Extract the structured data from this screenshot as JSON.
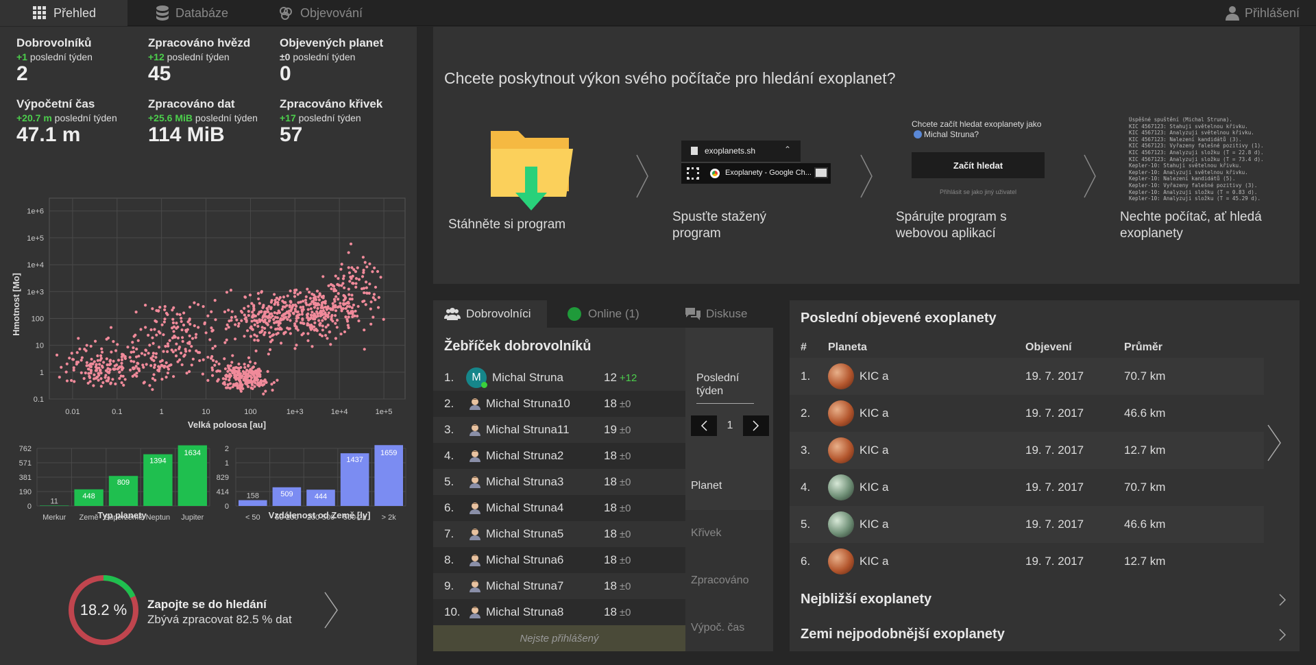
{
  "nav": {
    "tabs": [
      "Přehled",
      "Databáze",
      "Objevování"
    ],
    "login": "Přihlášení"
  },
  "stats": [
    {
      "title": "Dobrovolníků",
      "delta": "+1",
      "period": "poslední týden",
      "value": "2"
    },
    {
      "title": "Zpracováno hvězd",
      "delta": "+12",
      "period": "poslední týden",
      "value": "45"
    },
    {
      "title": "Objevených planet",
      "delta": "±0",
      "period": "poslední týden",
      "value": "0"
    },
    {
      "title": "Výpočetní čas",
      "delta": "+20.7 m",
      "period": "poslední týden",
      "value": "47.1 m"
    },
    {
      "title": "Zpracováno dat",
      "delta": "+25.6 MiB",
      "period": "poslední týden",
      "value": "114 MiB"
    },
    {
      "title": "Zpracováno křivek",
      "delta": "+17",
      "period": "poslední týden",
      "value": "57"
    }
  ],
  "chart_data": [
    {
      "type": "scatter",
      "xlabel": "Velká poloosa [au]",
      "ylabel": "Hmotnost [Mo]",
      "x_scale": "log",
      "y_scale": "log",
      "x_ticks": [
        "0.01",
        "0.1",
        "1",
        "10",
        "100",
        "1e+3",
        "1e+4",
        "1e+5"
      ],
      "y_ticks": [
        "0.1",
        "1",
        "10",
        "100",
        "1e+3",
        "1e+4",
        "1e+5",
        "1e+6"
      ],
      "xlim": [
        0.003,
        300000.0
      ],
      "ylim": [
        0.1,
        3000000.0
      ],
      "grid": true,
      "color": "#f08a9a",
      "clusters": [
        {
          "x": 0.03,
          "y": 3
        },
        {
          "x": 0.05,
          "y": 1
        },
        {
          "x": 0.3,
          "y": 2
        },
        {
          "x": 3,
          "y": 20
        },
        {
          "x": 50,
          "y": 0.8
        },
        {
          "x": 100,
          "y": 0.5
        },
        {
          "x": 300,
          "y": 100
        },
        {
          "x": 3000,
          "y": 200
        },
        {
          "x": 20000,
          "y": 1000
        }
      ]
    },
    {
      "type": "bar",
      "xlabel": "Typ planety",
      "categories": [
        "Merkur",
        "Země",
        "Superzemě",
        "Neptun",
        "Jupiter"
      ],
      "values": [
        11,
        448,
        809,
        1394,
        1634
      ],
      "y_ticks": [
        "0",
        "190",
        "381",
        "571",
        "762"
      ],
      "color": "#1fbf4f"
    },
    {
      "type": "bar",
      "xlabel": "Vzdálenost od Země [ly]",
      "categories": [
        "< 50",
        "50-200",
        "200-500",
        "500-2k",
        "> 2k"
      ],
      "values": [
        158,
        509,
        444,
        1437,
        1659
      ],
      "y_ticks": [
        "0",
        "414",
        "829",
        "1",
        "2"
      ],
      "color": "#7b8cf2"
    }
  ],
  "join": {
    "percent": "18.2 %",
    "progress": 0.182,
    "title": "Zapojte se do hledání",
    "subtitle": "Zbývá zpracovat 82.5 % dat"
  },
  "howto": {
    "title": "Chcete poskytnout výkon svého počítače pro hledání exoplanet?",
    "steps": [
      "Stáhněte si program",
      "Spusťte stažený program",
      "Spárujte program s webovou aplikací",
      "Nechte počítač, ať hledá exoplanety"
    ],
    "download_file": "exoplanets.sh",
    "taskbar_label": "Exoplanety - Google Ch...",
    "pair_prompt": "Chcete začít hledat exoplanety jako",
    "pair_user": "Michal Struna?",
    "pair_button": "Začít hledat",
    "pair_other": "Přihlásit se jako jiný uživatel",
    "log": [
      "Úspěšné spuštění (Michal Struna).",
      "KIC 4567123: Stahuji světelnou křivku.",
      "KIC 4567123: Analyzuji světelnou křivku.",
      "KIC 4567123: Nalezení kandidátů (3).",
      "KIC 4567123: Vyřazeny falešné pozitivy (1).",
      "KIC 4567123: Analyzuji složku (T = 22.8 d).",
      "KIC 4567123: Analyzuji složku (T = 73.4 d).",
      "Kepler-10: Stahuji světelnou křivku.",
      "Kepler-10: Analyzuji světelnou křivku.",
      "Kepler-10: Nalezení kandidátů (5).",
      "Kepler-10: Vyřazeny falešné pozitivy (3).",
      "Kepler-10: Analyzuji složku (T = 0.83 d).",
      "Kepler-10: Analyzuji složku (T = 45.29 d)."
    ]
  },
  "leaderboard": {
    "tabs": [
      "Dobrovolníci",
      "Online (1)",
      "Diskuse"
    ],
    "title": "Žebříček dobrovolníků",
    "rows": [
      {
        "rank": "1.",
        "name": "Michal Struna",
        "score": "12",
        "delta": "+12"
      },
      {
        "rank": "2.",
        "name": "Michal Struna10",
        "score": "18",
        "delta": "±0"
      },
      {
        "rank": "3.",
        "name": "Michal Struna11",
        "score": "19",
        "delta": "±0"
      },
      {
        "rank": "4.",
        "name": "Michal Struna2",
        "score": "18",
        "delta": "±0"
      },
      {
        "rank": "5.",
        "name": "Michal Struna3",
        "score": "18",
        "delta": "±0"
      },
      {
        "rank": "6.",
        "name": "Michal Struna4",
        "score": "18",
        "delta": "±0"
      },
      {
        "rank": "7.",
        "name": "Michal Struna5",
        "score": "18",
        "delta": "±0"
      },
      {
        "rank": "8.",
        "name": "Michal Struna6",
        "score": "18",
        "delta": "±0"
      },
      {
        "rank": "9.",
        "name": "Michal Struna7",
        "score": "18",
        "delta": "±0"
      },
      {
        "rank": "10.",
        "name": "Michal Struna8",
        "score": "18",
        "delta": "±0"
      }
    ],
    "avatar_letter": "M",
    "not_logged": "Nejste přihlášený",
    "period": "Poslední týden",
    "page": "1",
    "categories": [
      "Planet",
      "Křivek",
      "Zpracováno",
      "Výpoč. čas"
    ]
  },
  "exoplanets": {
    "title": "Poslední objevené exoplanety",
    "headers": [
      "#",
      "Planeta",
      "Objevení",
      "Průměr"
    ],
    "rows": [
      {
        "n": "1.",
        "name": "KIC a",
        "date": "19. 7. 2017",
        "diam": "70.7 km",
        "type": "gas"
      },
      {
        "n": "2.",
        "name": "KIC a",
        "date": "19. 7. 2017",
        "diam": "46.6 km",
        "type": "gas"
      },
      {
        "n": "3.",
        "name": "KIC a",
        "date": "19. 7. 2017",
        "diam": "12.7 km",
        "type": "gas"
      },
      {
        "n": "4.",
        "name": "KIC a",
        "date": "19. 7. 2017",
        "diam": "70.7 km",
        "type": "rocky"
      },
      {
        "n": "5.",
        "name": "KIC a",
        "date": "19. 7. 2017",
        "diam": "46.6 km",
        "type": "rocky"
      },
      {
        "n": "6.",
        "name": "KIC a",
        "date": "19. 7. 2017",
        "diam": "12.7 km",
        "type": "gas"
      }
    ],
    "nearest": "Nejbližší exoplanety",
    "earthlike": "Zemi nejpodobnější exoplanety"
  }
}
